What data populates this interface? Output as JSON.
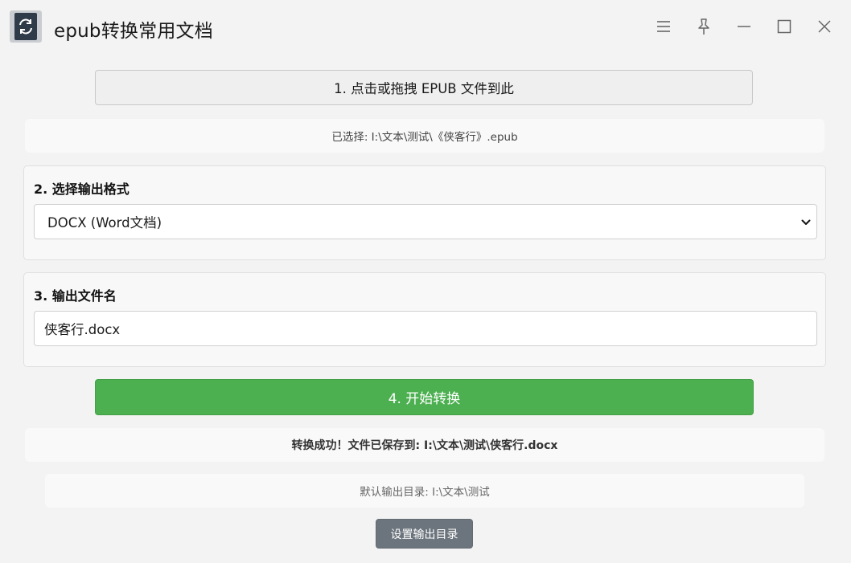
{
  "window": {
    "title": "epub转换常用文档",
    "icons": [
      "app-logo-icon",
      "menu-icon",
      "pin-icon",
      "minimize-icon",
      "maximize-icon",
      "close-icon"
    ]
  },
  "steps": {
    "upload_label": "1. 点击或拖拽 EPUB 文件到此",
    "selected_file_text": "已选择: I:\\文本\\测试\\《侠客行》.epub",
    "format_label": "2. 选择输出格式",
    "format_selected": "DOCX (Word文档)",
    "filename_label": "3. 输出文件名",
    "filename_value": "侠客行.docx",
    "convert_label": "4. 开始转换"
  },
  "status": {
    "result_text": "转换成功！文件已保存到: I:\\文本\\测试\\侠客行.docx",
    "default_dir_text": "默认输出目录: I:\\文本\\测试"
  },
  "actions": {
    "set_dir_label": "设置输出目录"
  },
  "colors": {
    "background": "#f3f3f3",
    "primary_button": "#4caf50",
    "secondary_button": "#6c757d"
  }
}
